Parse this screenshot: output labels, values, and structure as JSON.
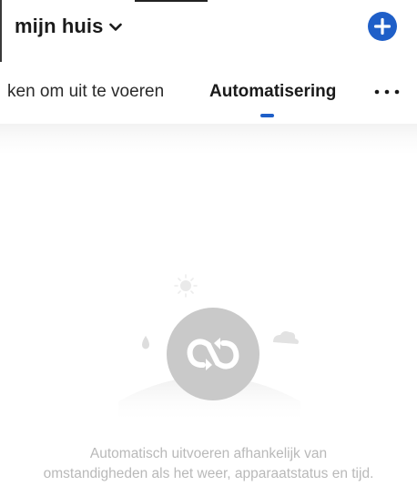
{
  "header": {
    "home_name": "mijn huis"
  },
  "tabs": [
    {
      "label": "ken om uit te voeren",
      "selected": false
    },
    {
      "label": "Automatisering",
      "selected": true
    }
  ],
  "empty_state": {
    "line1": "Automatisch uitvoeren afhankelijk van",
    "line2": "omstandigheden als het weer, apparaatstatus en tijd."
  },
  "icons": {
    "home_chevron": "chevron-down-icon",
    "add": "plus-icon",
    "more": "more-icon",
    "illustration": "automation-loop-icon"
  },
  "colors": {
    "accent": "#1f5fc8",
    "text": "#1a1a1a",
    "muted_text": "#b9b9b9",
    "illustration_circle": "#c9c9c9"
  }
}
